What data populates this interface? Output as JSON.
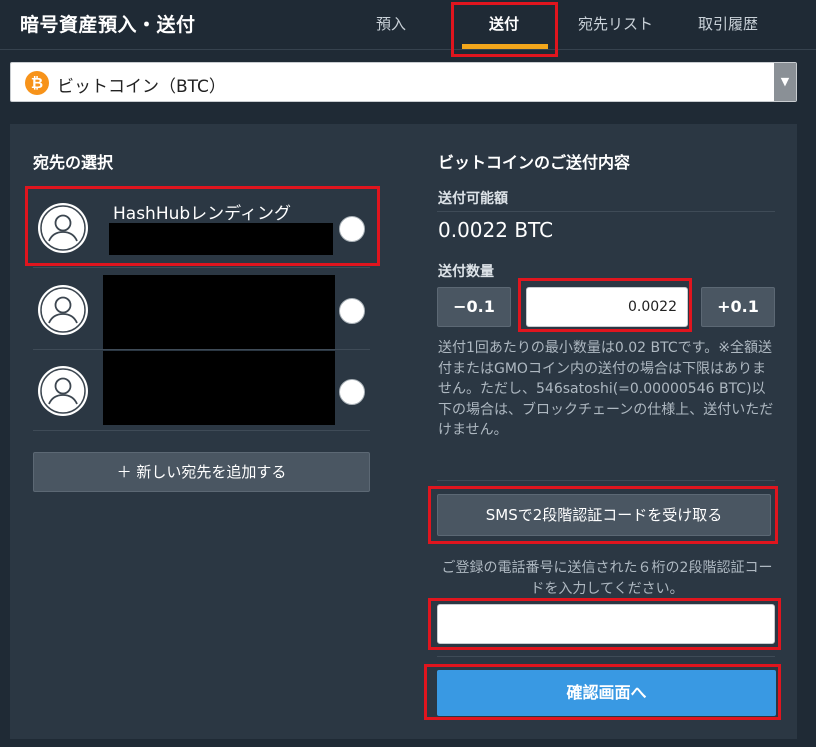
{
  "header": {
    "title": "暗号資産預入・送付",
    "tabs": [
      {
        "label": "預入"
      },
      {
        "label": "送付",
        "active": true
      },
      {
        "label": "宛先リスト"
      },
      {
        "label": "取引履歴"
      }
    ]
  },
  "currency_select": {
    "icon_symbol": "₿",
    "selected": "ビットコイン（BTC）",
    "arrow": "▼"
  },
  "recipients": {
    "title": "宛先の選択",
    "items": [
      {
        "name": "HashHubレンディング"
      },
      {
        "name": ""
      },
      {
        "name": ""
      }
    ],
    "add_button": "＋ 新しい宛先を追加する"
  },
  "send": {
    "title": "ビットコインのご送付内容",
    "available_label": "送付可能額",
    "available_amount": "0.0022 BTC",
    "qty_label": "送付数量",
    "minus_label": "−0.1",
    "plus_label": "+0.1",
    "qty_value": "0.0022",
    "note": "送付1回あたりの最小数量は0.02 BTCです。※全額送付またはGMOコイン内の送付の場合は下限はありません。ただし、546satoshi(=0.00000546 BTC)以下の場合は、ブロックチェーンの仕様上、送付いただけません。",
    "sms_button": "SMSで2段階認証コードを受け取る",
    "sms_note": "ご登録の電話番号に送信された６桁の2段階認証コードを入力してください。",
    "code_value": "",
    "confirm_button": "確認画面へ"
  },
  "colors": {
    "background": "#1f2a35",
    "panel": "#2b3743",
    "accent_tab": "#f2a61b",
    "confirm": "#3999e3",
    "highlight": "#e0151e",
    "bitcoin": "#f7931a"
  }
}
